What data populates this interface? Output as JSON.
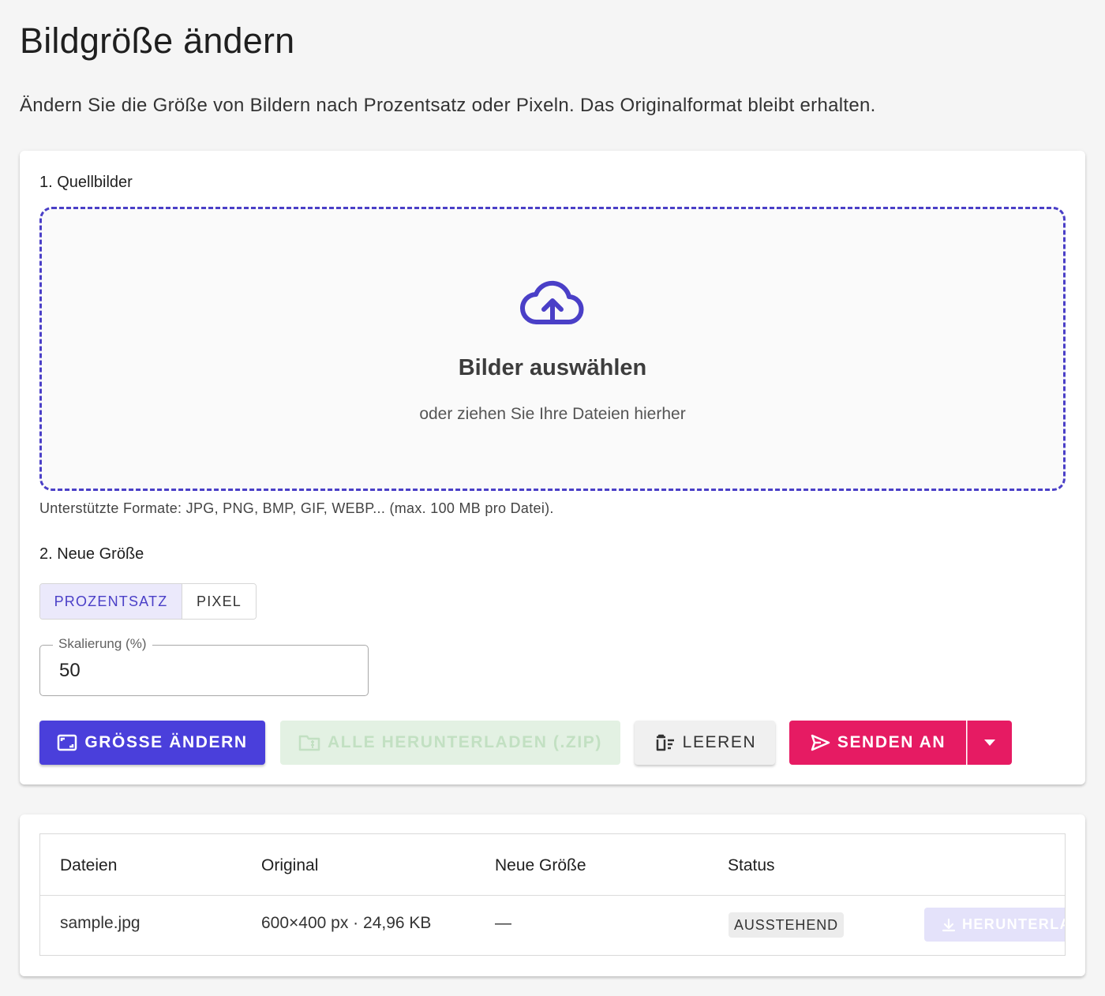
{
  "page": {
    "title": "Bildgröße ändern",
    "description": "Ändern Sie die Größe von Bildern nach Prozentsatz oder Pixeln. Das Originalformat bleibt erhalten."
  },
  "source": {
    "section_label": "1. Quellbilder",
    "dropzone_title": "Bilder auswählen",
    "dropzone_subtitle": "oder ziehen Sie Ihre Dateien hierher",
    "dropzone_icon": "cloud-upload-icon",
    "formats_note": "Unterstützte Formate: JPG, PNG, BMP, GIF, WEBP... (max. 100 MB pro Datei)."
  },
  "resize": {
    "section_label": "2. Neue Größe",
    "modes": [
      {
        "label": "PROZENTSATZ",
        "active": true
      },
      {
        "label": "PIXEL",
        "active": false
      }
    ],
    "scale_field": {
      "label": "Skalierung (%)",
      "value": "50"
    }
  },
  "actions": {
    "resize_label": "GRÖSSE ÄNDERN",
    "download_all_label": "ALLE HERUNTERLADEN (.ZIP)",
    "clear_label": "LEEREN",
    "send_label": "SENDEN AN"
  },
  "table": {
    "headers": [
      "Dateien",
      "Original",
      "Neue Größe",
      "Status"
    ],
    "rows": [
      {
        "file": "sample.jpg",
        "original": "600×400 px · 24,96 KB",
        "new_size": "—",
        "status": "AUSSTEHEND",
        "download_label": "HERUNTERLADEN"
      }
    ]
  },
  "colors": {
    "primary": "#4a3fdb",
    "accent": "#e61b63",
    "dropzone_border": "#4a3fc7",
    "download_disabled": "#e3f1e3"
  }
}
